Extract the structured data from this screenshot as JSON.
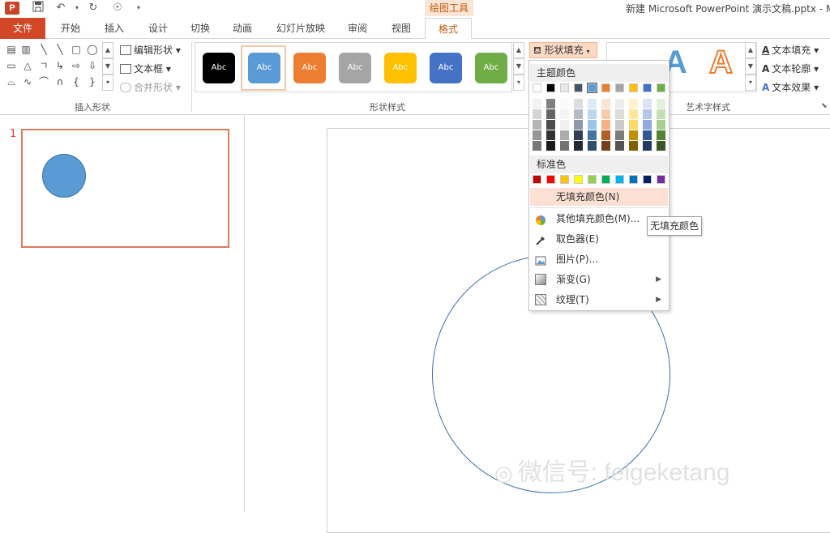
{
  "app": {
    "icon_letter": "P",
    "context_tab": "绘图工具",
    "window_title": "新建 Microsoft PowerPoint 演示文稿.pptx - M"
  },
  "quick_access": {
    "save_icon": "save-icon",
    "undo_icon": "undo-icon",
    "redo_icon": "redo-icon",
    "touch_icon": "touch-mode-icon"
  },
  "tabs": [
    {
      "label": "文件"
    },
    {
      "label": "开始"
    },
    {
      "label": "插入"
    },
    {
      "label": "设计"
    },
    {
      "label": "切换"
    },
    {
      "label": "动画"
    },
    {
      "label": "幻灯片放映"
    },
    {
      "label": "审阅"
    },
    {
      "label": "视图"
    },
    {
      "label": "格式"
    }
  ],
  "ribbon": {
    "insert_shapes": {
      "label": "插入形状",
      "edit_shape": "编辑形状",
      "text_box": "文本框",
      "merge_shapes": "合并形状"
    },
    "shape_styles": {
      "label": "形状样式",
      "items": [
        {
          "text": "Abc",
          "color": "#000000"
        },
        {
          "text": "Abc",
          "color": "#5b9bd5"
        },
        {
          "text": "Abc",
          "color": "#ed7d31"
        },
        {
          "text": "Abc",
          "color": "#a5a5a5"
        },
        {
          "text": "Abc",
          "color": "#ffc000"
        },
        {
          "text": "Abc",
          "color": "#4472c4"
        },
        {
          "text": "Abc",
          "color": "#70ad47"
        }
      ],
      "shape_fill": "形状填充"
    },
    "wordart_styles": {
      "label": "艺术字样式",
      "text_fill": "文本填充",
      "text_outline": "文本轮廓",
      "text_effects": "文本效果",
      "preview_letter": "A"
    }
  },
  "slides": {
    "number": "1"
  },
  "dropdown": {
    "theme_colors_header": "主题颜色",
    "theme_colors": [
      "#ffffff",
      "#000000",
      "#e7e6e6",
      "#44546a",
      "#5b9bd5",
      "#ed7d31",
      "#a5a5a5",
      "#ffc000",
      "#4472c4",
      "#70ad47"
    ],
    "standard_colors_header": "标准色",
    "standard_colors": [
      "#c00000",
      "#ff0000",
      "#ffc000",
      "#ffff00",
      "#92d050",
      "#00b050",
      "#00b0f0",
      "#0070c0",
      "#002060",
      "#7030a0"
    ],
    "no_fill": "无填充颜色(N)",
    "more_colors": "其他填充颜色(M)...",
    "eyedropper": "取色器(E)",
    "picture": "图片(P)...",
    "gradient": "渐变(G)",
    "texture": "纹理(T)"
  },
  "tooltip": "无填充颜色",
  "watermark": "微信号: feigeketang"
}
